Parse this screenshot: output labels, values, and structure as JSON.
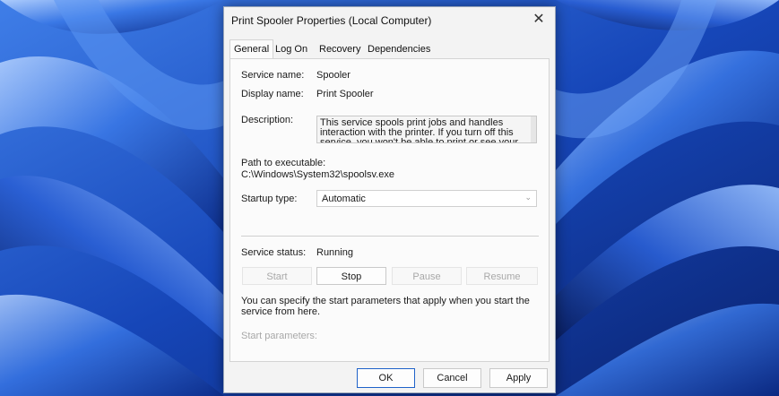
{
  "window": {
    "title": "Print Spooler Properties (Local Computer)",
    "close_glyph": "✕"
  },
  "tabs": [
    {
      "label": "General",
      "active": true
    },
    {
      "label": "Log On",
      "active": false
    },
    {
      "label": "Recovery",
      "active": false
    },
    {
      "label": "Dependencies",
      "active": false
    }
  ],
  "general": {
    "service_name_label": "Service name:",
    "service_name": "Spooler",
    "display_name_label": "Display name:",
    "display_name": "Print Spooler",
    "description_label": "Description:",
    "description": "This service spools print jobs and handles interaction with the printer.  If you turn off this service, you won't be able to print or see your printers.",
    "path_label": "Path to executable:",
    "path": "C:\\Windows\\System32\\spoolsv.exe",
    "startup_type_label": "Startup type:",
    "startup_type": "Automatic",
    "service_status_label": "Service status:",
    "service_status": "Running",
    "buttons": {
      "start": "Start",
      "stop": "Stop",
      "pause": "Pause",
      "resume": "Resume"
    },
    "info_text": "You can specify the start parameters that apply when you start the service from here.",
    "start_params_label": "Start parameters:"
  },
  "footer": {
    "ok": "OK",
    "cancel": "Cancel",
    "apply": "Apply"
  },
  "icons": {
    "close": "close-icon",
    "dropdown": "chevron-down-icon"
  },
  "colors": {
    "accent": "#1f62c9",
    "wallpaper": "#0b2a78",
    "dialog_bg": "#f3f3f3"
  }
}
